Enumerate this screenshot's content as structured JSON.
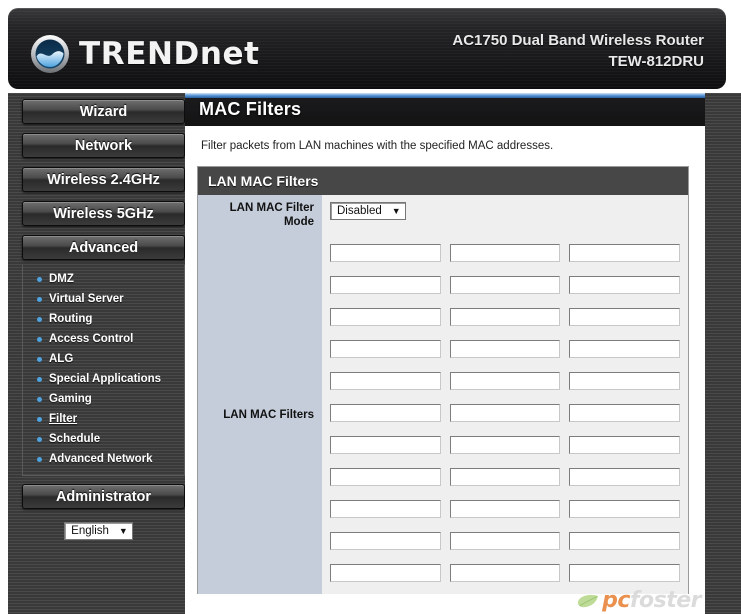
{
  "header": {
    "brand": "TRENDnet",
    "brand_icon": "trendnet-globe-logo",
    "product_line1": "AC1750 Dual Band Wireless Router",
    "product_line2": "TEW-812DRU"
  },
  "sidebar": {
    "buttons": [
      {
        "label": "Wizard"
      },
      {
        "label": "Network"
      },
      {
        "label": "Wireless 2.4GHz"
      },
      {
        "label": "Wireless 5GHz"
      },
      {
        "label": "Advanced"
      }
    ],
    "advanced_submenu": [
      {
        "label": "DMZ",
        "active": false
      },
      {
        "label": "Virtual Server",
        "active": false
      },
      {
        "label": "Routing",
        "active": false
      },
      {
        "label": "Access Control",
        "active": false
      },
      {
        "label": "ALG",
        "active": false
      },
      {
        "label": "Special Applications",
        "active": false
      },
      {
        "label": "Gaming",
        "active": false
      },
      {
        "label": "Filter",
        "active": true
      },
      {
        "label": "Schedule",
        "active": false
      },
      {
        "label": "Advanced Network",
        "active": false
      }
    ],
    "admin_button": {
      "label": "Administrator"
    },
    "language_select": {
      "value": "English",
      "caret_icon": "chevron-down-icon"
    }
  },
  "main": {
    "page_title": "MAC Filters",
    "intro": "Filter packets from LAN machines with the specified MAC addresses.",
    "panel": {
      "title": "LAN MAC Filters",
      "mode_label": "LAN MAC Filter Mode",
      "mode_select": {
        "value": "Disabled",
        "caret_icon": "chevron-down-icon"
      },
      "filters_label": "LAN MAC Filters",
      "filter_columns": 3,
      "filter_rows": 11,
      "filter_placeholder": "",
      "filter_values": [
        [
          "",
          "",
          ""
        ],
        [
          "",
          "",
          ""
        ],
        [
          "",
          "",
          ""
        ],
        [
          "",
          "",
          ""
        ],
        [
          "",
          "",
          ""
        ],
        [
          "",
          "",
          ""
        ],
        [
          "",
          "",
          ""
        ],
        [
          "",
          "",
          ""
        ],
        [
          "",
          "",
          ""
        ],
        [
          "",
          "",
          ""
        ],
        [
          "",
          "",
          ""
        ]
      ]
    }
  },
  "watermark": {
    "text_strong": "pc",
    "text_dim": "foster",
    "leaf_icon": "leaf-icon"
  },
  "colors": {
    "accent_blue": "#4ea3e0",
    "header_dark": "#1a1a1c",
    "label_cell": "#c5cdda",
    "panel_head": "#474747",
    "watermark_orange": "#e8863c"
  }
}
